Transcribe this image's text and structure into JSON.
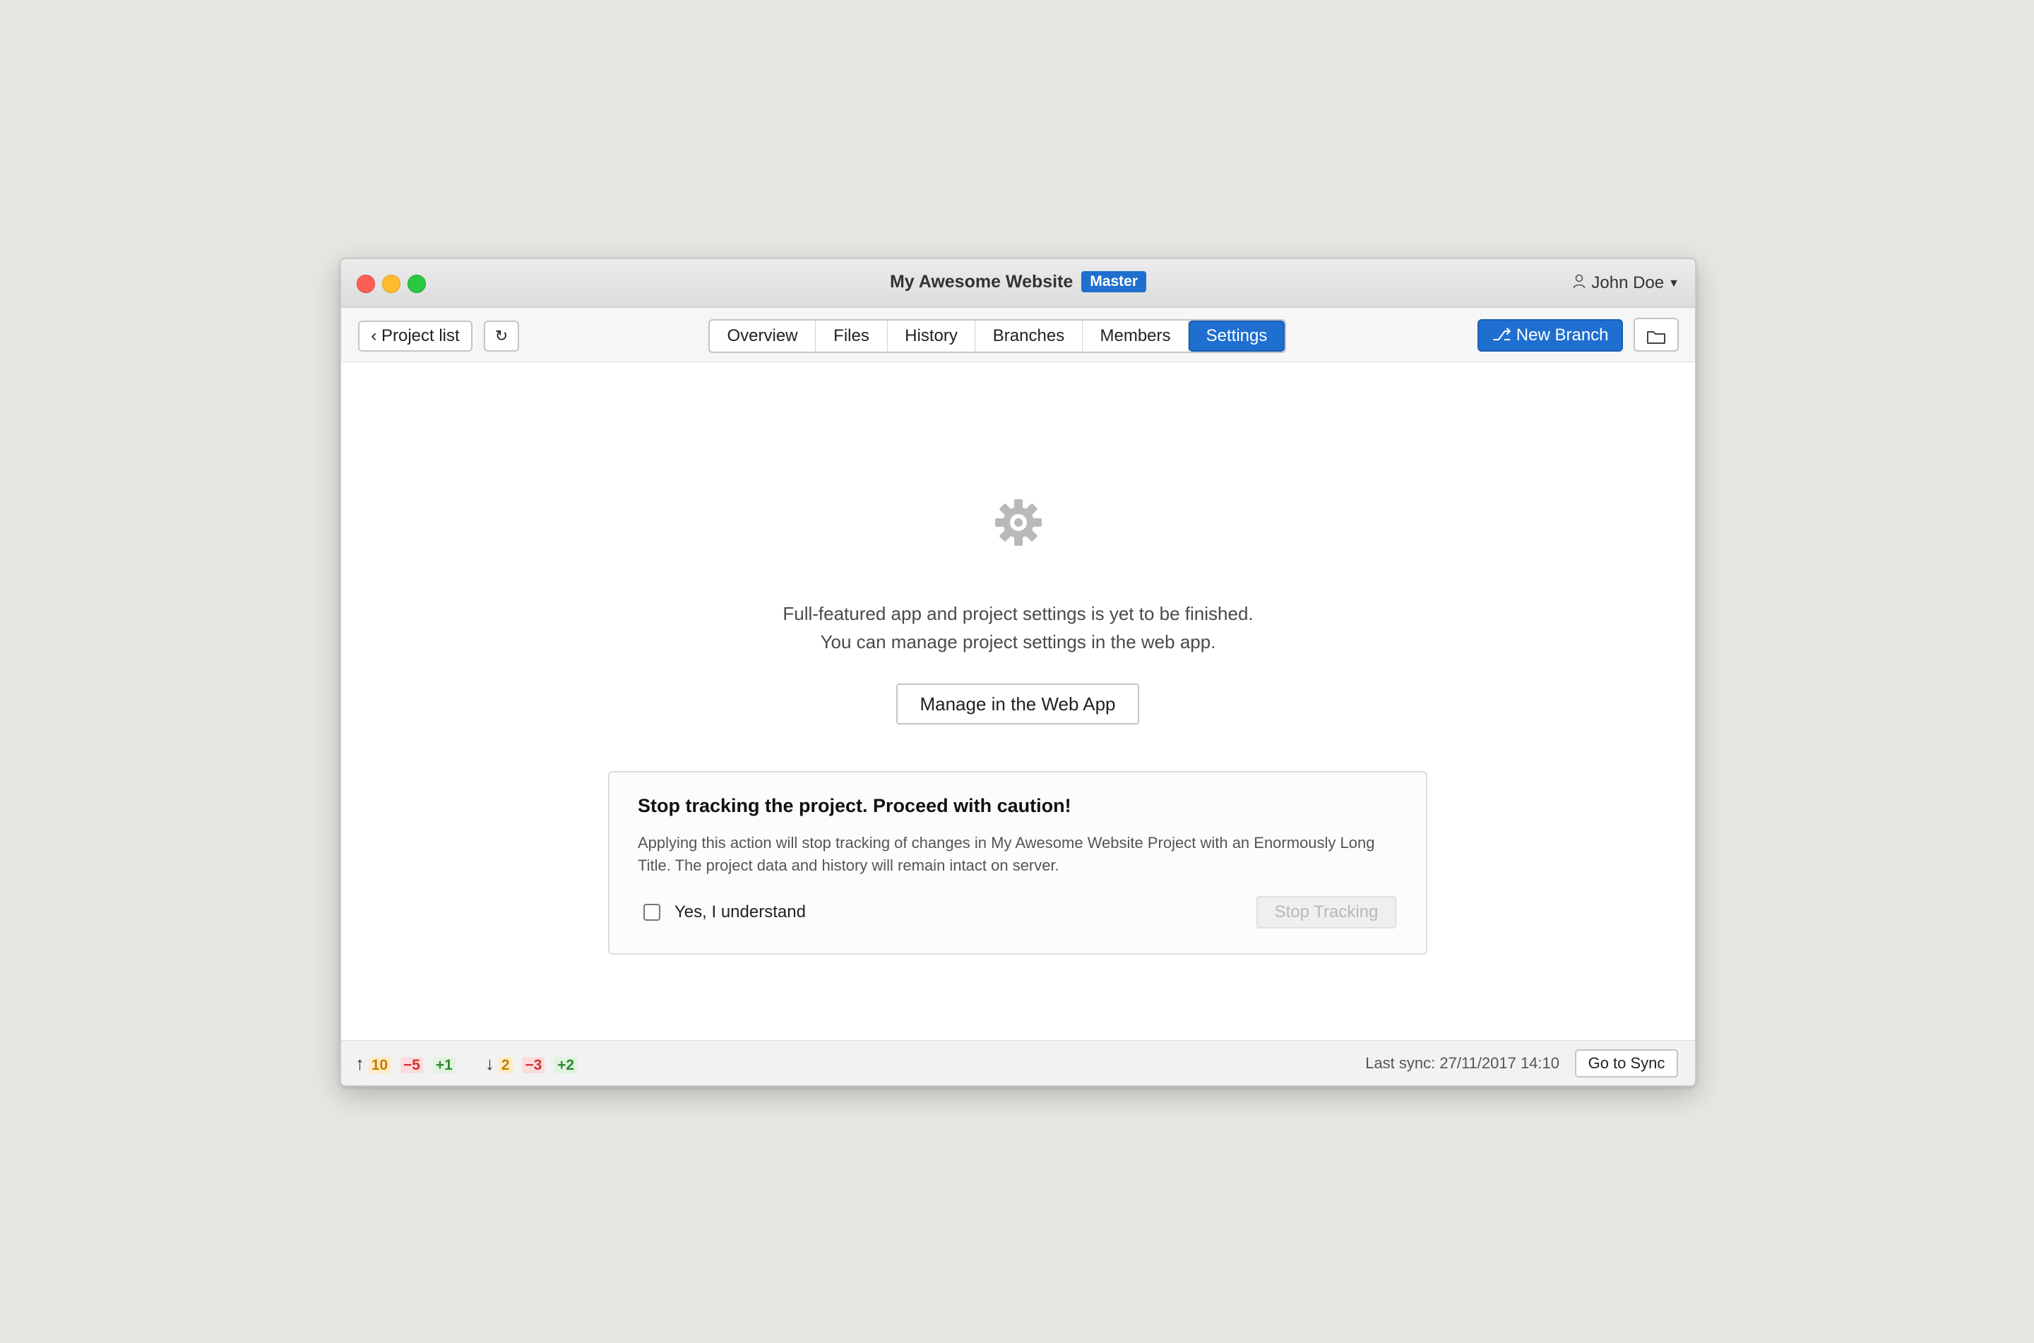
{
  "window": {
    "title": "My Awesome Website",
    "branch_badge": "Master",
    "user": "John Doe"
  },
  "toolbar": {
    "back_label": "‹ Project list",
    "refresh_icon": "↻",
    "tabs": [
      {
        "label": "Overview",
        "active": false
      },
      {
        "label": "Files",
        "active": false
      },
      {
        "label": "History",
        "active": false
      },
      {
        "label": "Branches",
        "active": false
      },
      {
        "label": "Members",
        "active": false
      },
      {
        "label": "Settings",
        "active": true
      }
    ],
    "new_branch_label": "New Branch",
    "new_branch_icon": "⎇"
  },
  "main": {
    "icon": "gear-icon",
    "message_line1": "Full-featured app and project settings is yet to be finished.",
    "message_line2": "You can manage project settings in the web app.",
    "manage_label": "Manage in the Web App"
  },
  "caution": {
    "title": "Stop tracking the project. Proceed with caution!",
    "text": "Applying this action will stop tracking of changes in My Awesome Website Project with an Enormously Long Title. The project data and history will remain intact on server.",
    "checkbox_label": "Yes, I understand",
    "checked": false,
    "stop_label": "Stop Tracking"
  },
  "status": {
    "up_arrow": "↑",
    "up_modified": "10",
    "up_removed": "−5",
    "up_added": "+1",
    "down_arrow": "↓",
    "down_modified": "2",
    "down_removed": "−3",
    "down_added": "+2",
    "last_sync": "Last sync: 27/11/2017 14:10",
    "go_to_sync_label": "Go to Sync"
  },
  "colors": {
    "accent": "#1e6fcf",
    "background": "#e7e6e1"
  }
}
